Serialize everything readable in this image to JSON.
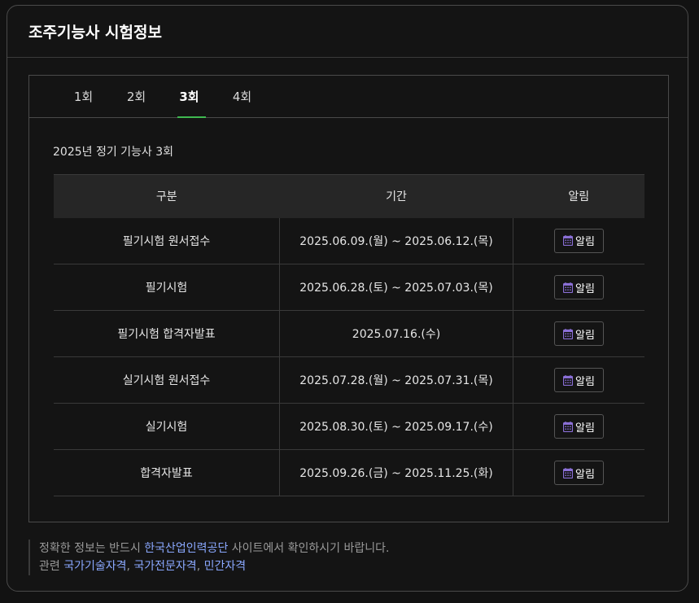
{
  "header": {
    "title": "조주기능사 시험정보"
  },
  "tabs": [
    {
      "label": "1회",
      "active": false
    },
    {
      "label": "2회",
      "active": false
    },
    {
      "label": "3회",
      "active": true
    },
    {
      "label": "4회",
      "active": false
    }
  ],
  "section_title": "2025년 정기 기능사 3회",
  "table": {
    "headers": [
      "구분",
      "기간",
      "알림"
    ],
    "rows": [
      {
        "category": "필기시험 원서접수",
        "period": "2025.06.09.(월) ~ 2025.06.12.(목)",
        "alarm": "알림"
      },
      {
        "category": "필기시험",
        "period": "2025.06.28.(토) ~ 2025.07.03.(목)",
        "alarm": "알림"
      },
      {
        "category": "필기시험 합격자발표",
        "period": "2025.07.16.(수)",
        "alarm": "알림"
      },
      {
        "category": "실기시험 원서접수",
        "period": "2025.07.28.(월) ~ 2025.07.31.(목)",
        "alarm": "알림"
      },
      {
        "category": "실기시험",
        "period": "2025.08.30.(토) ~ 2025.09.17.(수)",
        "alarm": "알림"
      },
      {
        "category": "합격자발표",
        "period": "2025.09.26.(금) ~ 2025.11.25.(화)",
        "alarm": "알림"
      }
    ]
  },
  "footer": {
    "line1_prefix": "정확한 정보는 반드시 ",
    "line1_link": "한국산업인력공단",
    "line1_suffix": " 사이트에서 확인하시기 바랍니다.",
    "line2_prefix": "관련 ",
    "links": [
      "국가기술자격",
      "국가전문자격",
      "민간자격"
    ],
    "separator": ", "
  },
  "colors": {
    "accent_tab_underline": "#3fb950",
    "link": "#8aa8ff",
    "calendar_icon": "#8a6fd6"
  },
  "icons": {
    "alarm": "calendar-icon"
  }
}
